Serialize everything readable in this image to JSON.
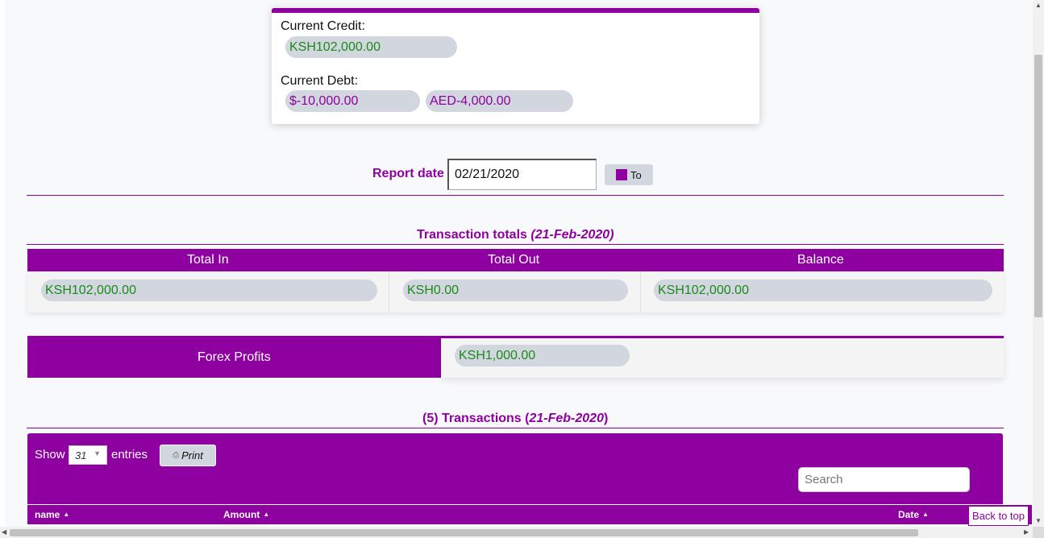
{
  "credit_card": {
    "credit_label": "Current Credit:",
    "credit_value": "KSH102,000.00",
    "debt_label": "Current Debt:",
    "debt_values": [
      "$-10,000.00",
      "AED-4,000.00"
    ]
  },
  "report": {
    "label": "Report date",
    "date_value": "02/21/2020",
    "to_label": "To"
  },
  "totals": {
    "title": "Transaction totals",
    "title_date": "(21-Feb-2020)",
    "headers": [
      "Total In",
      "Total Out",
      "Balance"
    ],
    "values": [
      "KSH102,000.00",
      "KSH0.00",
      "KSH102,000.00"
    ]
  },
  "forex": {
    "label": "Forex Profits",
    "value": "KSH1,000.00"
  },
  "transactions": {
    "title_count": "(5) Transactions (",
    "title_date": "21-Feb-2020",
    "title_close": ")",
    "show_label": "Show",
    "entries_select": "31",
    "entries_label": "entries",
    "print_label": "Print",
    "search_placeholder": "Search",
    "columns": [
      "name",
      "Amount",
      "Date"
    ]
  },
  "back_to_top": "Back to top",
  "colors": {
    "accent": "#8e00a0",
    "positive": "#1a8a1a",
    "pill_bg": "#d2d6de"
  },
  "icons": {
    "print": "printer-icon",
    "to_square": "square-icon",
    "sort": "sort-arrow-icon"
  }
}
